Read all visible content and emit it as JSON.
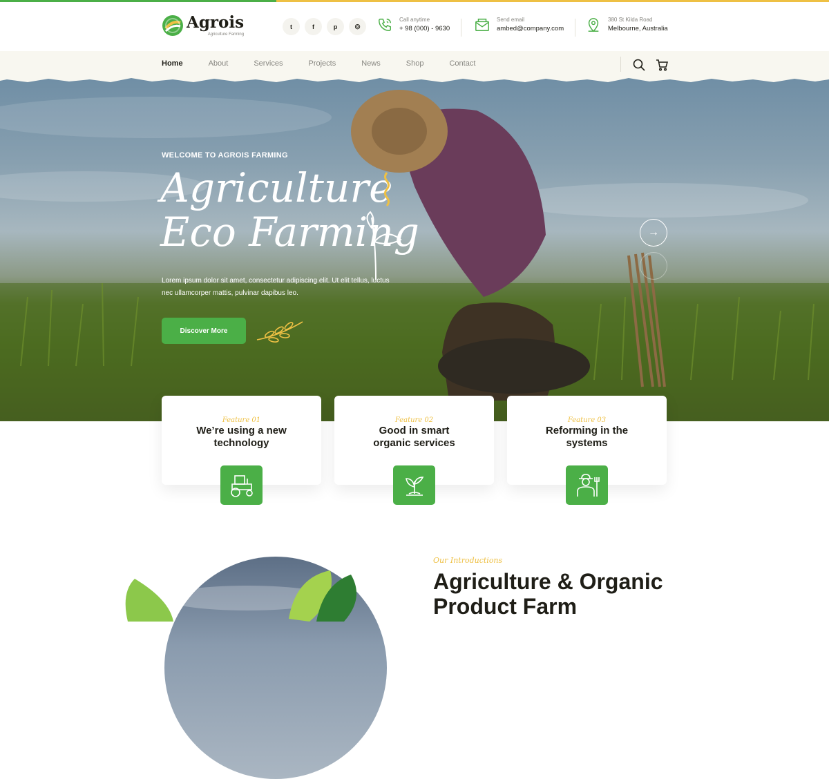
{
  "brand": {
    "name": "Agrois",
    "tagline": "Agriculture Farming"
  },
  "socials": [
    {
      "icon": "twitter-icon",
      "glyph": "t"
    },
    {
      "icon": "facebook-icon",
      "glyph": "f"
    },
    {
      "icon": "pinterest-icon",
      "glyph": "p"
    },
    {
      "icon": "instagram-icon",
      "glyph": "◎"
    }
  ],
  "contact": {
    "phone_label": "Call anytime",
    "phone_value": "+ 98 (000) - 9630",
    "email_label": "Send email",
    "email_value": "ambed@company.com",
    "address_line1": "380 St Kilda Road",
    "address_line2": "Melbourne, Australia"
  },
  "nav": {
    "items": [
      "Home",
      "About",
      "Services",
      "Projects",
      "News",
      "Shop",
      "Contact"
    ],
    "active": "Home"
  },
  "hero": {
    "subtitle": "WELCOME TO AGROIS FARMING",
    "title_line1": "Agriculture",
    "title_line2": "Eco Farming",
    "description": "Lorem ipsum dolor sit amet, consectetur adipiscing elit. Ut elit tellus, luctus nec ullamcorper mattis, pulvinar dapibus leo.",
    "button": "Discover More",
    "next_arrow": "→"
  },
  "features": [
    {
      "tag": "Feature 01",
      "title": "We’re using a new technology",
      "icon": "tractor-icon"
    },
    {
      "tag": "Feature 02",
      "title": "Good in smart organic services",
      "icon": "plant-icon"
    },
    {
      "tag": "Feature 03",
      "title": "Reforming in the systems",
      "icon": "farmer-icon"
    }
  ],
  "intro": {
    "tag": "Our Introductions",
    "title_line1": "Agriculture & Organic",
    "title_line2": "Product Farm"
  },
  "colors": {
    "green": "#4baf47",
    "yellow": "#eec044",
    "dark": "#1f1e17",
    "gray": "#878680",
    "nav_bg": "#f8f7f0"
  }
}
